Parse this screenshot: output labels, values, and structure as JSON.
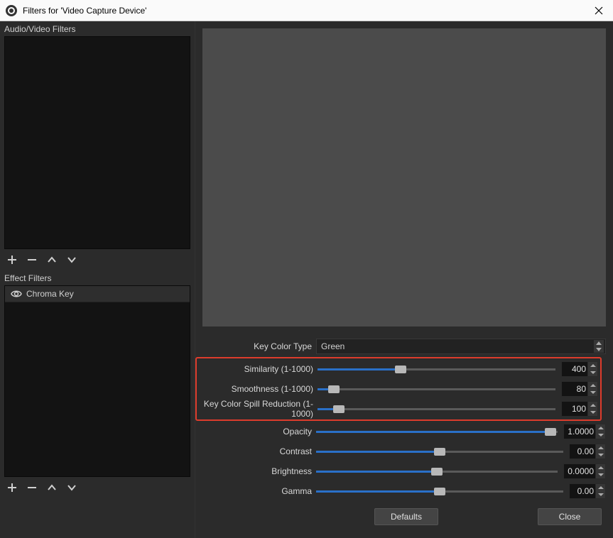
{
  "title": "Filters for 'Video Capture Device'",
  "sidebar": {
    "audio_label": "Audio/Video Filters",
    "effect_label": "Effect Filters",
    "effect_items": [
      {
        "name": "Chroma Key"
      }
    ]
  },
  "props": {
    "key_color_type": {
      "label": "Key Color Type",
      "value": "Green"
    },
    "similarity": {
      "label": "Similarity (1-1000)",
      "value": "400",
      "min": 1,
      "max": 1000
    },
    "smoothness": {
      "label": "Smoothness (1-1000)",
      "value": "80",
      "min": 1,
      "max": 1000
    },
    "spill": {
      "label": "Key Color Spill Reduction (1-1000)",
      "value": "100",
      "min": 1,
      "max": 1000
    },
    "opacity": {
      "label": "Opacity",
      "value": "1.0000",
      "fillpct": 100
    },
    "contrast": {
      "label": "Contrast",
      "value": "0.00",
      "fillpct": 50
    },
    "brightness": {
      "label": "Brightness",
      "value": "0.0000",
      "fillpct": 50
    },
    "gamma": {
      "label": "Gamma",
      "value": "0.00",
      "fillpct": 50
    }
  },
  "buttons": {
    "defaults": "Defaults",
    "close": "Close"
  }
}
